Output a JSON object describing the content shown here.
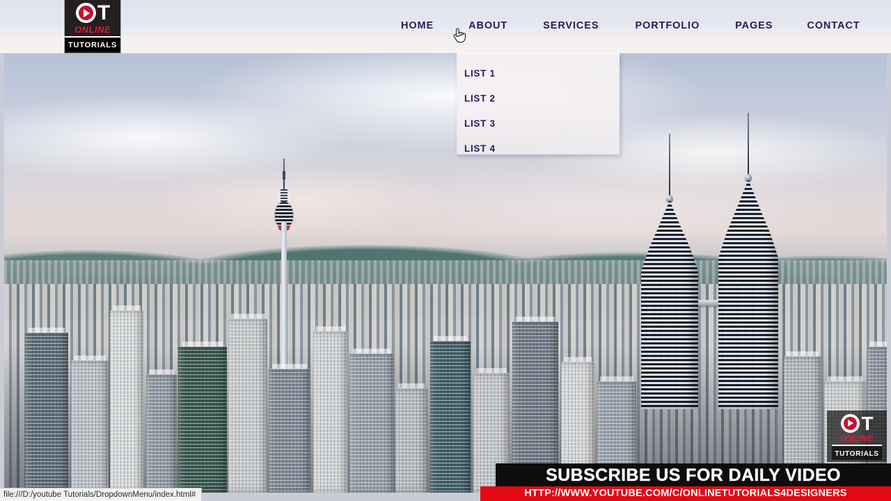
{
  "header": {
    "logo": {
      "mark_o": "O",
      "mark_t": "T",
      "online": "ONLINE",
      "tutorials": "TUTORIALS"
    },
    "nav": [
      {
        "label": "HOME",
        "name": "nav-item-home"
      },
      {
        "label": "ABOUT",
        "name": "nav-item-about"
      },
      {
        "label": "SERVICES",
        "name": "nav-item-services"
      },
      {
        "label": "PORTFOLIO",
        "name": "nav-item-portfolio"
      },
      {
        "label": "PAGES",
        "name": "nav-item-pages"
      },
      {
        "label": "CONTACT",
        "name": "nav-item-contact"
      }
    ]
  },
  "dropdown": {
    "parent": "ABOUT",
    "items": [
      {
        "label": "LIST 1"
      },
      {
        "label": "LIST 2"
      },
      {
        "label": "LIST 3"
      },
      {
        "label": "LIST 4"
      }
    ]
  },
  "hero": {
    "alt": "Kuala Lumpur city skyline with KL Tower and Petronas Twin Towers"
  },
  "watermark": {
    "mark_o": "O",
    "mark_t": "T",
    "online": "ONLINE",
    "tutorials": "TUTORIALS"
  },
  "subscribe": {
    "headline": "SUBSCRIBE US FOR DAILY VIDEO",
    "url": "HTTP://WWW.YOUTUBE.COM/C/ONLINETUTORIALS4DESIGNERS"
  },
  "statusbar": {
    "url": "file:///D:/youtube Tutorials/DropdownMenu/index.html#"
  },
  "colors": {
    "nav_text": "#2b1a56",
    "brand_red": "#d0213c",
    "subscribe_red": "#e50914",
    "logo_bg": "#231f20",
    "header_bg": "#e4e7f0"
  }
}
